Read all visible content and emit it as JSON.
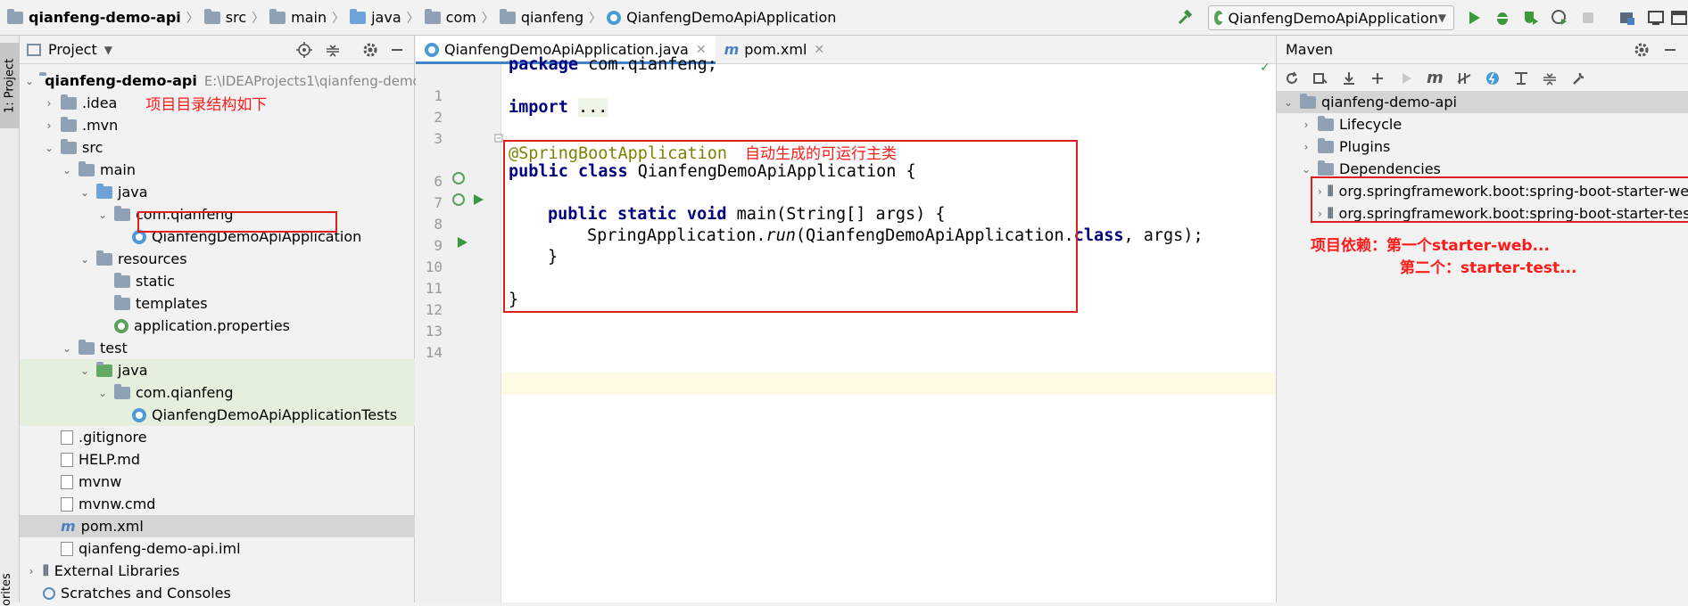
{
  "breadcrumb": [
    "qianfeng-demo-api",
    "src",
    "main",
    "java",
    "com",
    "qianfeng",
    "QianfengDemoApiApplication"
  ],
  "run_config": "QianfengDemoApiApplication",
  "left_strip": {
    "project_tab": "1: Project",
    "favorites_tab": "orites"
  },
  "project": {
    "title": "Project",
    "root_name": "qianfeng-demo-api",
    "root_path": "E:\\IDEAProjects1\\qianfeng-demo",
    "annotation": "项目目录结构如下",
    "items": {
      "idea": ".idea",
      "mvn": ".mvn",
      "src": "src",
      "main": "main",
      "java": "java",
      "pkg": "com.qianfeng",
      "app": "QianfengDemoApiApplication",
      "resources": "resources",
      "static": "static",
      "templates": "templates",
      "props": "application.properties",
      "test": "test",
      "test_java": "java",
      "test_pkg": "com.qianfeng",
      "test_app": "QianfengDemoApiApplicationTests",
      "gitignore": ".gitignore",
      "help": "HELP.md",
      "mvnw": "mvnw",
      "mvnwcmd": "mvnw.cmd",
      "pom": "pom.xml",
      "iml": "qianfeng-demo-api.iml",
      "extlib": "External Libraries",
      "scratches": "Scratches and Consoles"
    }
  },
  "editor": {
    "tabs": [
      "QianfengDemoApiApplication.java",
      "pom.xml"
    ],
    "line_numbers": [
      "1",
      "2",
      "3",
      "6",
      "7",
      "8",
      "9",
      "10",
      "11",
      "12",
      "13",
      "14"
    ],
    "code": {
      "pkg_kw": "package",
      "pkg_name": " com.qianfeng;",
      "import_kw": "import",
      "import_fold": "...",
      "annotation": "@SpringBootApplication",
      "class_line_kw": "public class",
      "class_line_rest": " QianfengDemoApiApplication {",
      "main_kw": "public static void",
      "main_rest": " main(String[] args) {",
      "run_pre": "SpringApplication.",
      "run_method": "run",
      "run_mid": "(QianfengDemoApiApplication.",
      "run_class": "class",
      "run_post": ", args);",
      "close_inner": "}",
      "close_outer": "}"
    },
    "annotation_note": "自动生成的可运行主类"
  },
  "maven": {
    "title": "Maven",
    "root": "qianfeng-demo-api",
    "lifecycle": "Lifecycle",
    "plugins": "Plugins",
    "dependencies": "Dependencies",
    "dep1": "org.springframework.boot:spring-boot-starter-web",
    "dep2": "org.springframework.boot:spring-boot-starter-test",
    "note1": "项目依赖：第一个starter-web...",
    "note2": "第二个：starter-test..."
  },
  "colors": {
    "annotation_red": "#ff1a1a",
    "keyword": "#000080",
    "java_annotation": "#808000",
    "tab_accent": "#4083c9"
  }
}
